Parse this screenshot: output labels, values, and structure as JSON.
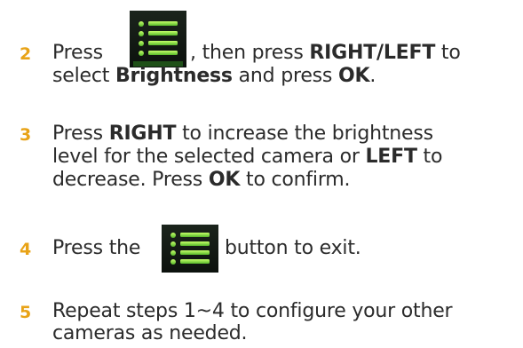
{
  "accent_color": "#e8a317",
  "icon_name": "menu-list-icon",
  "steps": [
    {
      "number": "2",
      "line1": {
        "a": "Press",
        "b": ", then press ",
        "c": "RIGHT/LEFT",
        "d": " to"
      },
      "line2": {
        "a": "select ",
        "b": "Brightness",
        "c": " and press ",
        "d": "OK",
        "e": "."
      }
    },
    {
      "number": "3",
      "line1": {
        "a": "Press ",
        "b": "RIGHT",
        "c": " to increase the brightness"
      },
      "line2": {
        "a": "level for the selected camera or ",
        "b": "LEFT",
        "c": " to"
      },
      "line3": {
        "a": "decrease. Press ",
        "b": "OK",
        "c": " to confirm."
      }
    },
    {
      "number": "4",
      "line1": {
        "a": "Press the",
        "b": "button to exit."
      }
    },
    {
      "number": "5",
      "line1": {
        "a": "Repeat steps 1~4 to configure your other"
      },
      "line2": {
        "a": "cameras as needed."
      }
    }
  ]
}
